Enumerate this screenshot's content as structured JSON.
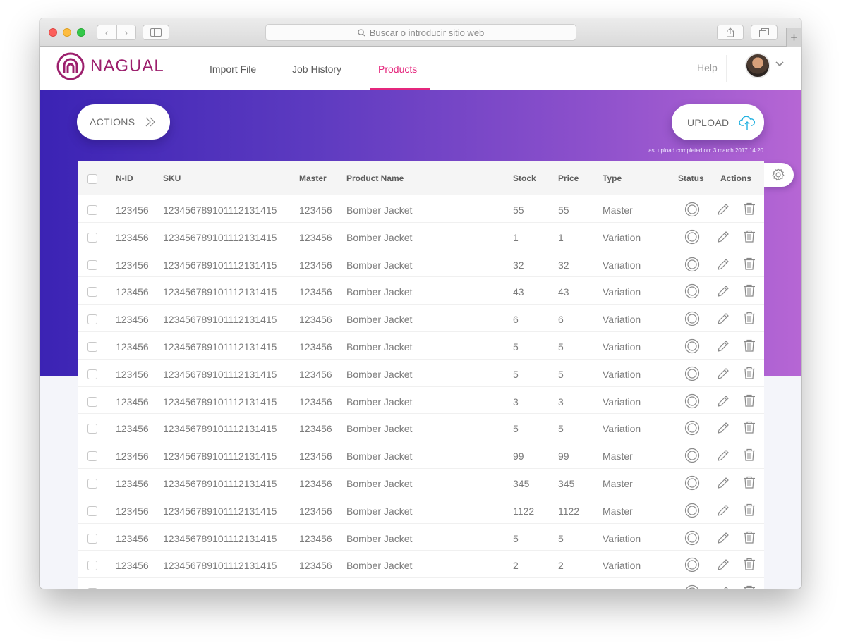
{
  "browser": {
    "address_placeholder": "Buscar o introducir sitio web"
  },
  "brand": {
    "name": "NAGUAL",
    "color": "#9c1f6d"
  },
  "nav": {
    "items": [
      {
        "label": "Import File"
      },
      {
        "label": "Job History"
      },
      {
        "label": "Products"
      }
    ],
    "active": "Products",
    "active_color": "#e4267c",
    "help": "Help"
  },
  "toolbar": {
    "actions_label": "ACTIONS",
    "upload_label": "UPLOAD",
    "last_upload": "last upload completed on: 3 march 2017 14:20"
  },
  "table": {
    "columns": [
      "N-ID",
      "SKU",
      "Master",
      "Product Name",
      "Stock",
      "Price",
      "Type",
      "Status",
      "Actions"
    ],
    "rows": [
      {
        "nid": "123456",
        "sku": "123456789101112131415",
        "master": "123456",
        "name": "Bomber Jacket",
        "stock": "55",
        "price": "55",
        "type": "Master"
      },
      {
        "nid": "123456",
        "sku": "123456789101112131415",
        "master": "123456",
        "name": "Bomber Jacket",
        "stock": "1",
        "price": "1",
        "type": "Variation"
      },
      {
        "nid": "123456",
        "sku": "123456789101112131415",
        "master": "123456",
        "name": "Bomber Jacket",
        "stock": "32",
        "price": "32",
        "type": "Variation"
      },
      {
        "nid": "123456",
        "sku": "123456789101112131415",
        "master": "123456",
        "name": "Bomber Jacket",
        "stock": "43",
        "price": "43",
        "type": "Variation"
      },
      {
        "nid": "123456",
        "sku": "123456789101112131415",
        "master": "123456",
        "name": "Bomber Jacket",
        "stock": "6",
        "price": "6",
        "type": "Variation"
      },
      {
        "nid": "123456",
        "sku": "123456789101112131415",
        "master": "123456",
        "name": "Bomber Jacket",
        "stock": "5",
        "price": "5",
        "type": "Variation"
      },
      {
        "nid": "123456",
        "sku": "123456789101112131415",
        "master": "123456",
        "name": "Bomber Jacket",
        "stock": "5",
        "price": "5",
        "type": "Variation"
      },
      {
        "nid": "123456",
        "sku": "123456789101112131415",
        "master": "123456",
        "name": "Bomber Jacket",
        "stock": "3",
        "price": "3",
        "type": "Variation"
      },
      {
        "nid": "123456",
        "sku": "123456789101112131415",
        "master": "123456",
        "name": "Bomber Jacket",
        "stock": "5",
        "price": "5",
        "type": "Variation"
      },
      {
        "nid": "123456",
        "sku": "123456789101112131415",
        "master": "123456",
        "name": "Bomber Jacket",
        "stock": "99",
        "price": "99",
        "type": "Master"
      },
      {
        "nid": "123456",
        "sku": "123456789101112131415",
        "master": "123456",
        "name": "Bomber Jacket",
        "stock": "345",
        "price": "345",
        "type": "Master"
      },
      {
        "nid": "123456",
        "sku": "123456789101112131415",
        "master": "123456",
        "name": "Bomber Jacket",
        "stock": "1122",
        "price": "1122",
        "type": "Master"
      },
      {
        "nid": "123456",
        "sku": "123456789101112131415",
        "master": "123456",
        "name": "Bomber Jacket",
        "stock": "5",
        "price": "5",
        "type": "Variation"
      },
      {
        "nid": "123456",
        "sku": "123456789101112131415",
        "master": "123456",
        "name": "Bomber Jacket",
        "stock": "2",
        "price": "2",
        "type": "Variation"
      },
      {
        "nid": "",
        "sku": "",
        "master": "",
        "name": "",
        "stock": "",
        "price": "",
        "type": ""
      }
    ]
  },
  "icons": {
    "status": "circle-status-icon",
    "edit": "pencil-icon",
    "delete": "trash-icon",
    "settings": "gear-icon",
    "upload": "cloud-upload-icon",
    "actions": "double-chevron-right-icon"
  }
}
